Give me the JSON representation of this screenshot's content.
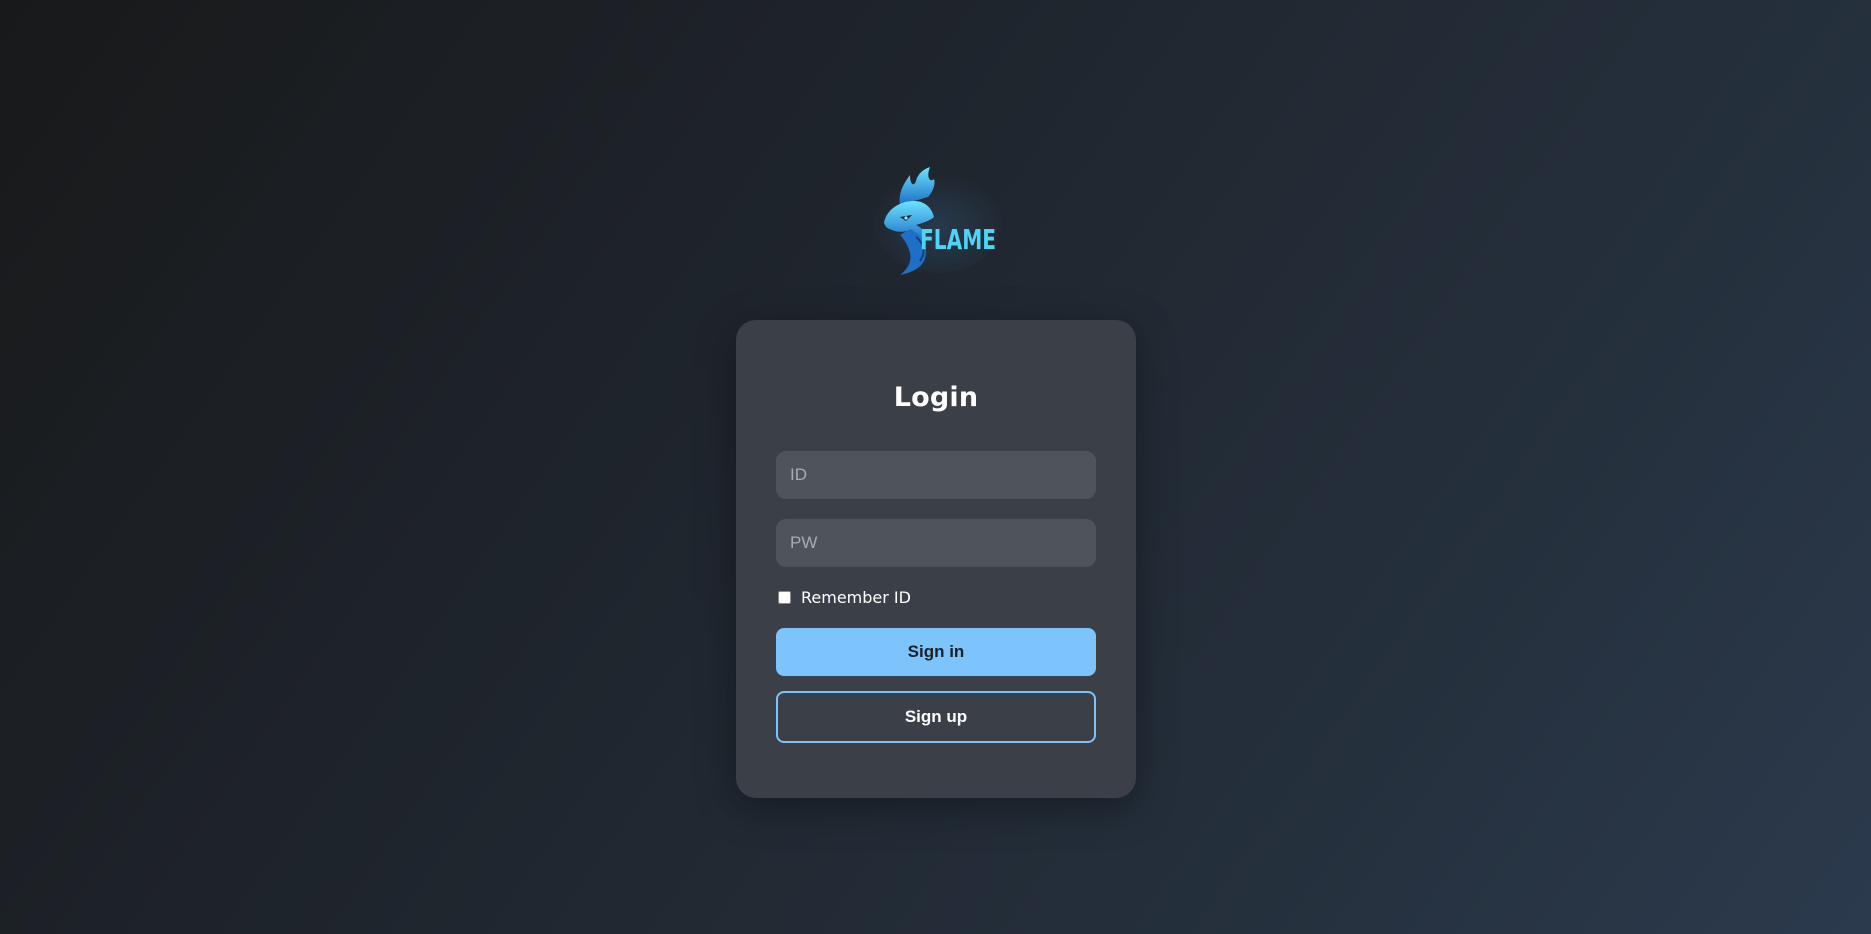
{
  "logo": {
    "text": "FLAME",
    "icon": "dragon-icon",
    "accent_color": "#4fd4f5"
  },
  "login": {
    "title": "Login",
    "id_placeholder": "ID",
    "id_value": "",
    "pw_placeholder": "PW",
    "pw_value": "",
    "remember_label": "Remember ID",
    "remember_checked": false,
    "signin_label": "Sign in",
    "signup_label": "Sign up"
  },
  "colors": {
    "primary": "#7cc4fb",
    "card": "#3a3f48",
    "input": "#4f545c"
  }
}
